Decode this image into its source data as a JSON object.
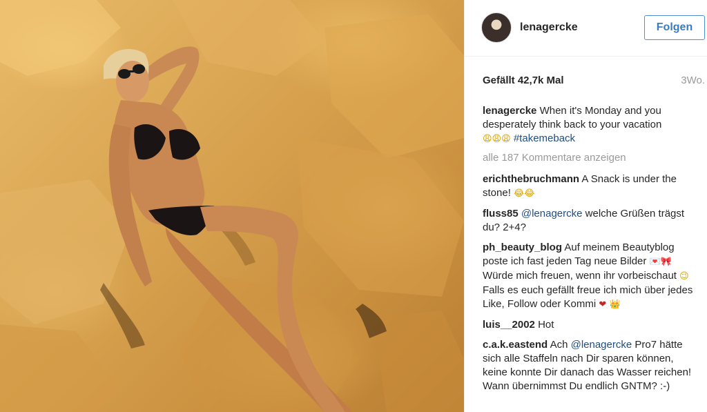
{
  "post": {
    "username": "lenagercke",
    "follow_label": "Folgen",
    "likes": "Gefällt 42,7k Mal",
    "time": "3Wo."
  },
  "caption": {
    "user": "lenagercke",
    "text": "When it's Monday and you desperately think back to your vacation",
    "emojis": "😩😩😩",
    "hashtag": "#takemeback"
  },
  "view_more": "alle 187 Kommentare anzeigen",
  "comments": [
    {
      "user": "erichthebruchmann",
      "text": "A Snack is under the stone!",
      "emoji": "😂😂"
    },
    {
      "user": "fluss85",
      "mention": "@lenagercke",
      "text": "welche Grüßen trägst du? 2+4?"
    },
    {
      "user": "ph_beauty_blog",
      "text_a": "Auf meinem Beautyblog poste ich fast jeden Tag neue Bilder",
      "emoji_a": "💌🎀",
      "text_b": "Würde mich freuen, wenn ihr vorbeischaut",
      "emoji_b": "😉",
      "text_c": "Falls es euch gefällt freue ich mich über jedes Like, Follow oder Kommi",
      "emoji_c": "❤",
      "emoji_d": "👑"
    },
    {
      "user": "luis__2002",
      "text": "Hot"
    },
    {
      "user": "c.a.k.eastend",
      "text_a": "Ach",
      "mention": "@lenagercke",
      "text_b": "Pro7 hätte sich alle Staffeln nach Dir sparen können, keine konnte Dir danach das Wasser reichen! Wann übernimmst Du endlich GNTM? :-)"
    }
  ],
  "colors": {
    "link": "#1e4d83",
    "follow": "#3a7bc4",
    "muted": "#999999",
    "text": "#262626"
  }
}
